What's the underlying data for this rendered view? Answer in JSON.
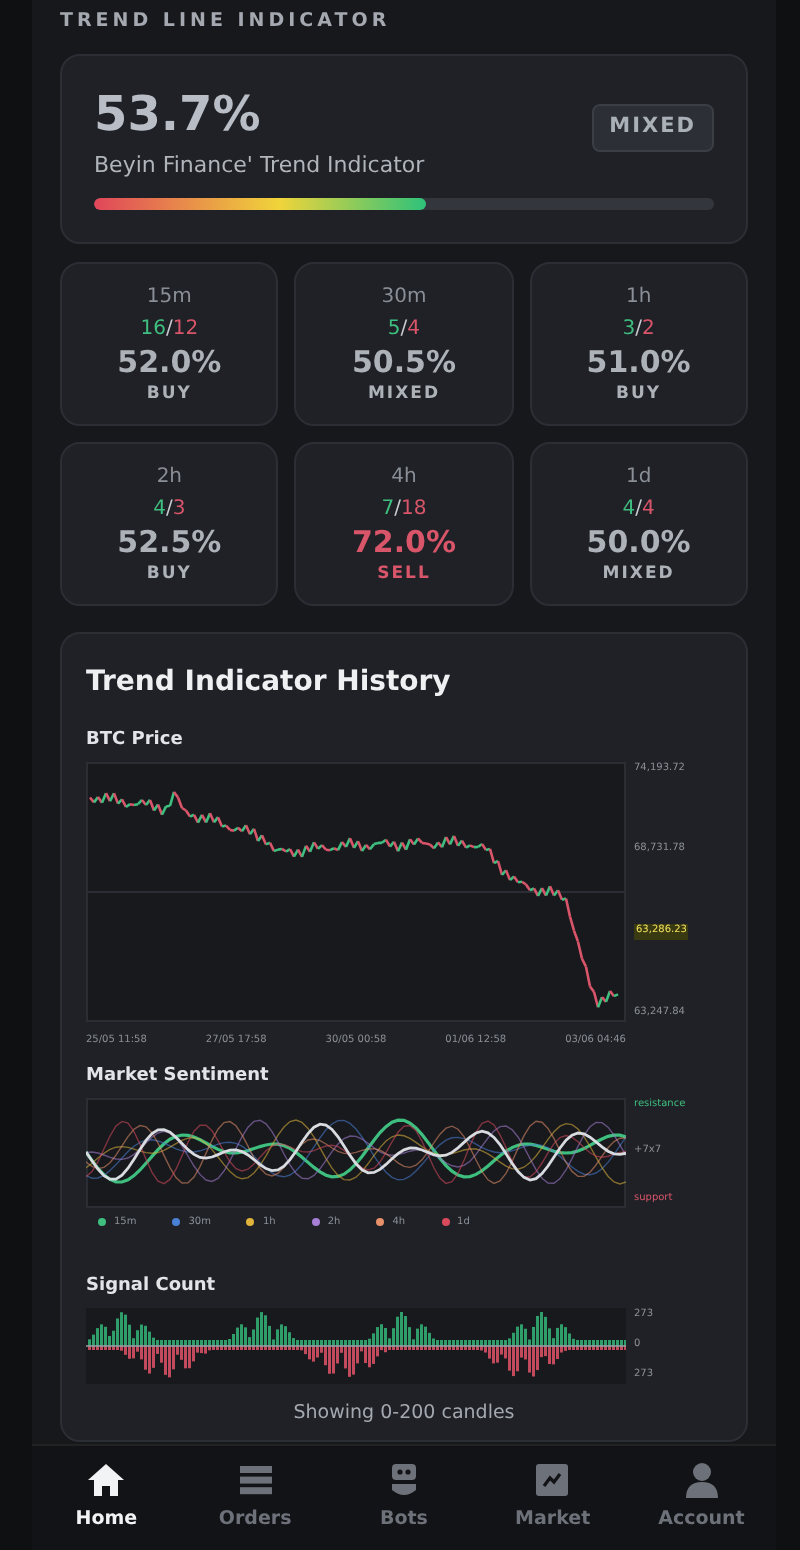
{
  "section_title": "TREND LINE INDICATOR",
  "summary": {
    "value": "53.7%",
    "label": "Beyin Finance' Trend Indicator",
    "badge": "MIXED",
    "level": 0.537
  },
  "timeframes": [
    {
      "label": "15m",
      "buy": "16",
      "separator": "/",
      "sell": "12",
      "percent": "52.0%",
      "signal": "BUY",
      "color": "#adb2b9"
    },
    {
      "label": "30m",
      "buy": "5",
      "separator": "/",
      "sell": "4",
      "percent": "50.5%",
      "signal": "MIXED",
      "color": "#adb2b9"
    },
    {
      "label": "1h",
      "buy": "3",
      "separator": "/",
      "sell": "2",
      "percent": "51.0%",
      "signal": "BUY",
      "color": "#adb2b9"
    },
    {
      "label": "2h",
      "buy": "4",
      "separator": "/",
      "sell": "3",
      "percent": "52.5%",
      "signal": "BUY",
      "color": "#adb2b9"
    },
    {
      "label": "4h",
      "buy": "7",
      "separator": "/",
      "sell": "18",
      "percent": "72.0%",
      "signal": "SELL",
      "color": "#d9556a"
    },
    {
      "label": "1d",
      "buy": "4",
      "separator": "/",
      "sell": "4",
      "percent": "50.0%",
      "signal": "MIXED",
      "color": "#adb2b9"
    }
  ],
  "history": {
    "title": "Trend Indicator History",
    "price_chart": {
      "title": "BTC Price",
      "y_labels": [
        "74,193.72",
        "68,731.78",
        "63,286.23",
        "63,247.84"
      ],
      "x_labels": [
        "25/05 11:58",
        "27/05 17:58",
        "30/05 00:58",
        "01/06 12:58",
        "03/06 04:46"
      ]
    },
    "sentiment_chart": {
      "title": "Market Sentiment",
      "y_labels": [
        "resistance",
        "+7x7",
        "support"
      ],
      "legend": [
        {
          "label": "15m",
          "color": "#3fbf7f"
        },
        {
          "label": "30m",
          "color": "#4a7fd6"
        },
        {
          "label": "1h",
          "color": "#e0b43a"
        },
        {
          "label": "2h",
          "color": "#a77fd6"
        },
        {
          "label": "4h",
          "color": "#e8906a"
        },
        {
          "label": "1d",
          "color": "#d94b5c"
        }
      ]
    },
    "signal_chart": {
      "title": "Signal Count",
      "y_labels": [
        "273",
        "0",
        "273"
      ]
    },
    "footer": "Showing 0-200 candles"
  },
  "nav": [
    {
      "label": "Home",
      "selected": true
    },
    {
      "label": "Orders",
      "selected": false
    },
    {
      "label": "Bots",
      "selected": false
    },
    {
      "label": "Market",
      "selected": false
    },
    {
      "label": "Account",
      "selected": false
    }
  ]
}
